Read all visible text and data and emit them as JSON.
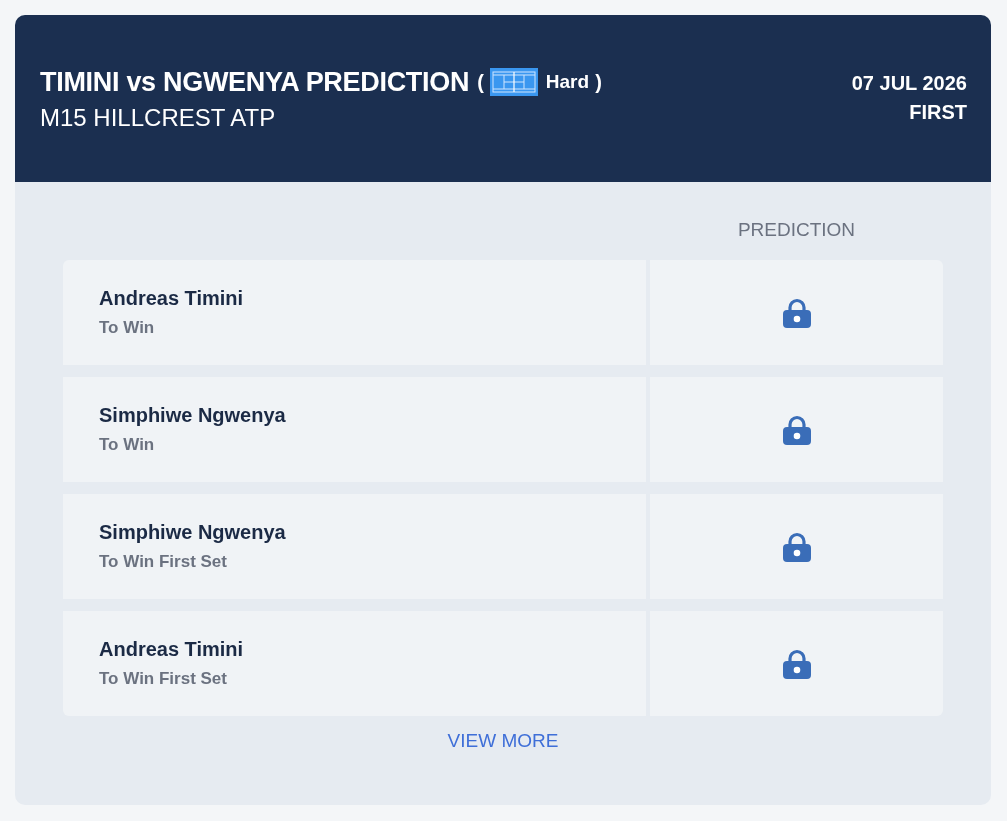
{
  "header": {
    "title": "TIMINI vs NGWENYA PREDICTION",
    "surface": {
      "open": "(",
      "name": "Hard",
      "close": ")"
    },
    "tournament": "M15 HILLCREST ATP",
    "date": "07 JUL 2026",
    "round": "FIRST"
  },
  "table": {
    "column_header": "PREDICTION",
    "rows": [
      {
        "player": "Andreas Timini",
        "market": "To Win",
        "locked": true
      },
      {
        "player": "Simphiwe Ngwenya",
        "market": "To Win",
        "locked": true
      },
      {
        "player": "Simphiwe Ngwenya",
        "market": "To Win First Set",
        "locked": true
      },
      {
        "player": "Andreas Timini",
        "market": "To Win First Set",
        "locked": true
      }
    ]
  },
  "view_more": "VIEW MORE"
}
